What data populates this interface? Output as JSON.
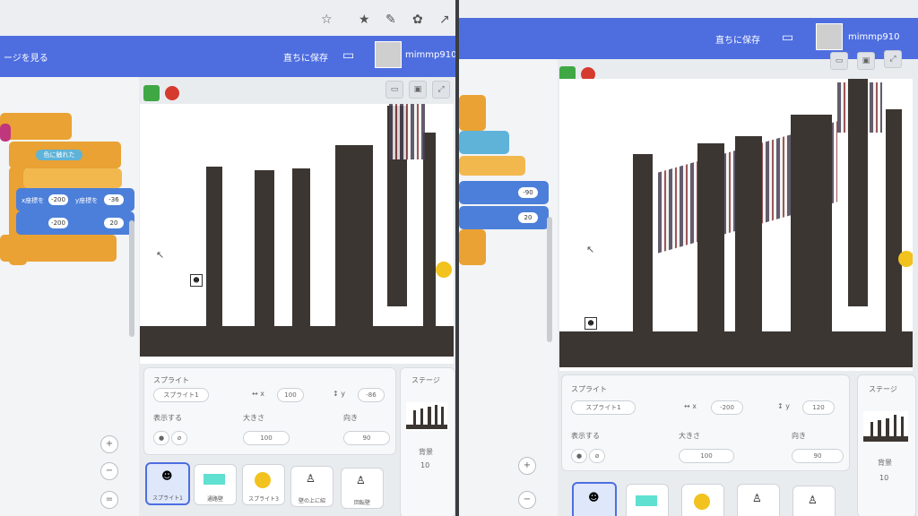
{
  "left": {
    "menu": {
      "save_now": "直ちに保存",
      "see_project_page": "ージを見る",
      "username": "mimmp910"
    },
    "sprite_info": {
      "sprite_label": "スプライト",
      "sprite_name": "スプライト1",
      "x_value": "100",
      "y_value": "-86",
      "show_label": "表示する",
      "size_label": "大きさ",
      "size_value": "100",
      "direction_label": "向き",
      "direction_value": "90"
    },
    "sprites": [
      {
        "name": "スプライト1"
      },
      {
        "name": "通路壁"
      },
      {
        "name": "スプライト3"
      },
      {
        "name": "壁の上に紹"
      },
      {
        "name": "回転壁"
      }
    ],
    "stage_panel": {
      "title": "ステージ",
      "backdrops_label": "背景",
      "backdrops_count": "10"
    },
    "blocks": {
      "touching": "色に触れた",
      "x_to": "x座標を",
      "x_val": "-200",
      "y_to": "y座標を",
      "y_val": "-36",
      "x_by": "-200",
      "y_by": "20"
    }
  },
  "right": {
    "menu": {
      "save_now": "直ちに保存",
      "username": "mimmp910"
    },
    "sprite_info": {
      "sprite_label": "スプライト",
      "sprite_name": "スプライト1",
      "x_value": "-200",
      "y_value": "120",
      "show_label": "表示する",
      "size_label": "大きさ",
      "size_value": "100",
      "direction_label": "向き",
      "direction_value": "90"
    },
    "stage_panel": {
      "title": "ステージ",
      "backdrops_label": "背景",
      "backdrops_count": "10"
    },
    "blocks": {
      "x_val": "-90",
      "y_val": "20"
    }
  },
  "colors": {
    "menu_blue": "#4e6ee0",
    "wall": "#3b3632",
    "flag_green": "#3fa845",
    "stop_red": "#d63a2f",
    "control_orange": "#e9a233",
    "motion_blue": "#4c7fd9"
  }
}
